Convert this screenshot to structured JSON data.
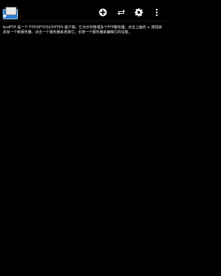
{
  "app": {
    "logo_icon": "andftp-logo-icon"
  },
  "toolbar": {
    "actions": [
      {
        "icon": "add-icon"
      },
      {
        "icon": "transfer-icon"
      },
      {
        "icon": "gear-icon"
      },
      {
        "icon": "overflow-menu-icon"
      }
    ]
  },
  "main": {
    "help_text": "AndFTP 是一个 FTP/SFTP/SCP/FTPS 客户端。它允许你管理多个FTP服务器。点击上面的 + 按钮来添加一个新服务器。点击一个服务器来连接它。长按一个服务器来编辑它的设置。"
  },
  "colors": {
    "background": "#000000",
    "text": "#f2f2f2",
    "icon": "#ffffff"
  }
}
